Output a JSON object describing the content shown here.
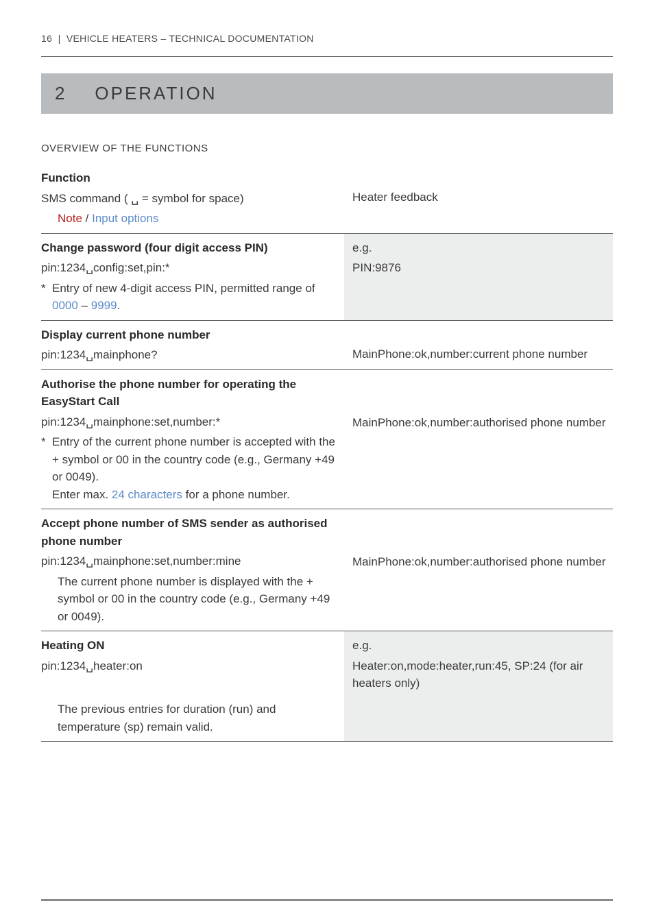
{
  "header": {
    "page_number": "16",
    "doc_title": "VEHICLE HEATERS – TECHNICAL DOCUMENTATION"
  },
  "section": {
    "number": "2",
    "title": "OPERATION"
  },
  "subheading": "OVERVIEW OF THE FUNCTIONS",
  "table": {
    "head": {
      "function_label": "Function",
      "sms_label_pre": "SMS command ( ",
      "sms_label_post": " = symbol for space)",
      "note_prefix": "Note",
      "note_sep": " / ",
      "note_link": "Input options",
      "feedback_label": "Heater feedback"
    },
    "rows": [
      {
        "title": "Change password (four digit access PIN)",
        "cmd": "pin:1234␣config:set,pin:*",
        "star_pre": "Entry of new 4-digit access PIN, permitted range of ",
        "opt1": "0000",
        "dash": " – ",
        "opt2": "9999",
        "post": ".",
        "fb_eg": "e.g.",
        "fb": "PIN:9876",
        "shade": true
      },
      {
        "title": "Display current phone number",
        "cmd": "pin:1234␣mainphone?",
        "fb": "MainPhone:ok,number:current phone number",
        "shade": false
      },
      {
        "title": "Authorise the phone number for operating the EasyStart Call",
        "cmd": "pin:1234␣mainphone:set,number:*",
        "star_pre": "Entry of the current phone number is accepted with the + symbol or 00 in the country code (e.g., Germany +49 or 0049).",
        "star_line2_pre": "Enter max. ",
        "star_line2_opt": "24 characters",
        "star_line2_post": " for a phone number.",
        "fb": "MainPhone:ok,number:authorised phone number",
        "shade": false
      },
      {
        "title": "Accept phone number of SMS sender as authorised phone number",
        "cmd": "pin:1234␣mainphone:set,number:mine",
        "note": "The current phone number is displayed with the + symbol or 00 in the country code (e.g., Germany +49 or 0049).",
        "fb": "MainPhone:ok,number:authorised phone number",
        "shade": false
      },
      {
        "title": "Heating ON",
        "cmd": "pin:1234␣heater:on",
        "note": "The previous entries for duration (run) and temperature (sp) remain valid.",
        "fb_eg": "e.g.",
        "fb": "Heater:on,mode:heater,run:45, SP:24 (for air heaters only)",
        "shade": true
      }
    ]
  }
}
